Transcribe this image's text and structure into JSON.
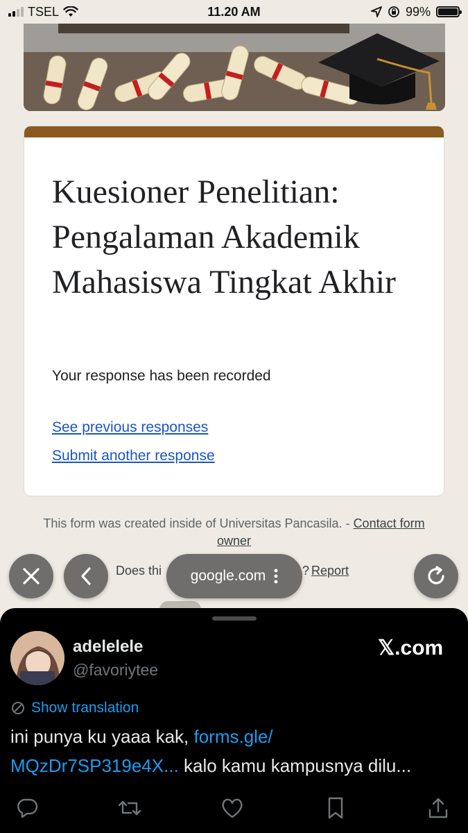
{
  "status_bar": {
    "carrier": "TSEL",
    "time": "11.20 AM",
    "battery_percent": "99%",
    "battery_level": 0.99,
    "icons": [
      "signal-icon",
      "wifi-icon",
      "location-icon",
      "rotation-lock-icon",
      "battery-icon"
    ]
  },
  "form": {
    "banner_icons": [
      "diploma-scroll-icon",
      "graduation-cap-icon"
    ],
    "accent_color": "#8a5a1f",
    "title": "Kuesioner Penelitian: Pengalaman Akademik Mahasiswa Tingkat Akhir",
    "response_message": "Your response has been recorded",
    "link_previous": "See previous responses",
    "link_another": "Submit another response",
    "footer_text": "This form was created inside of Universitas Pancasila. - ",
    "footer_contact": "Contact form owner",
    "abuse_text": "Does thi",
    "abuse_suffix": "?",
    "abuse_report": "Report"
  },
  "browser": {
    "url": "google.com",
    "buttons": [
      "close-icon",
      "back-icon",
      "more-icon",
      "reload-icon"
    ]
  },
  "tweet": {
    "display_name": "adelelele",
    "handle": "@favoriytee",
    "site_label": "𝕏.com",
    "show_translation": "Show translation",
    "text_line1_plain": "ini punya ku yaaa kak, ",
    "text_line1_link": "forms.gle/",
    "text_line2_link": "MQzDr7SP319e4X...",
    "text_line2_plain": " kalo kamu kampusnya dilu...",
    "action_icons": [
      "reply-icon",
      "retweet-icon",
      "like-icon",
      "bookmark-icon",
      "share-icon"
    ]
  }
}
